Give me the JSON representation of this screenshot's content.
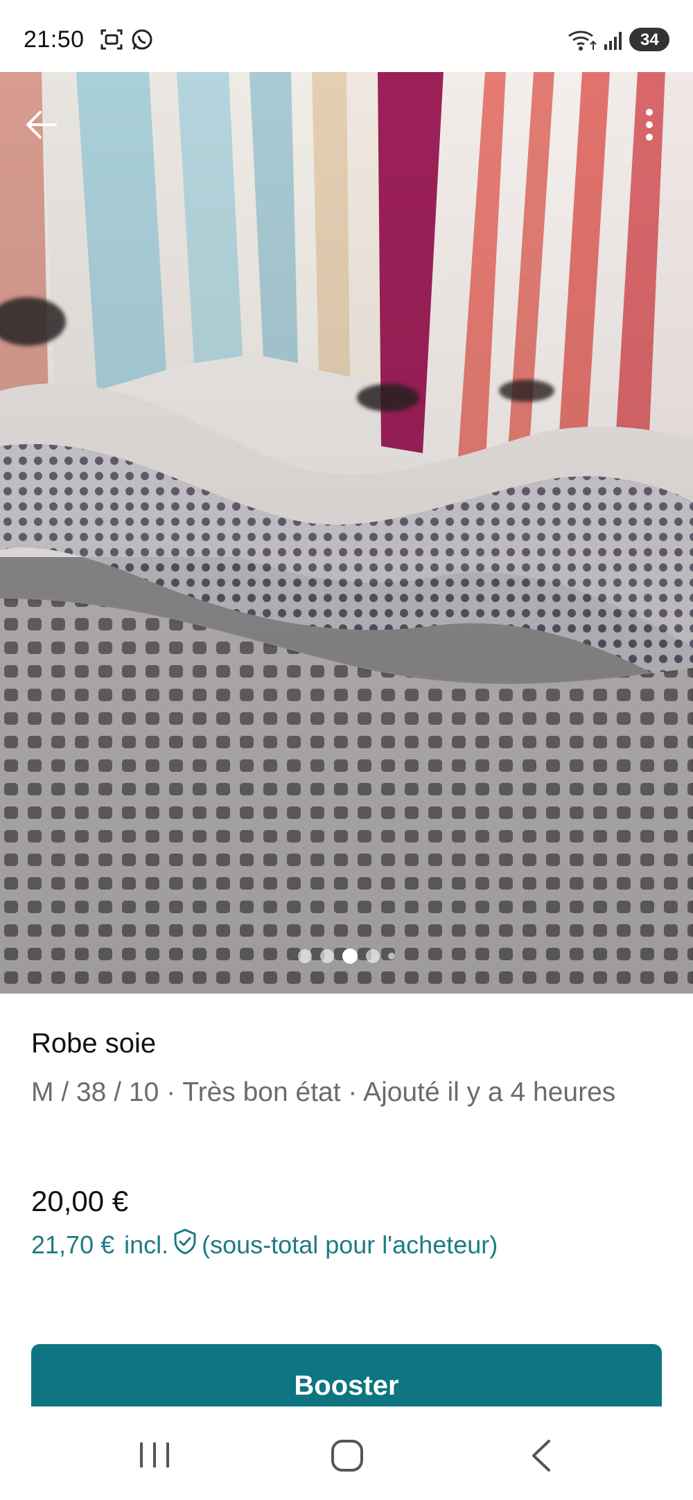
{
  "status_bar": {
    "time": "21:50",
    "battery": "34",
    "icons": [
      "screen-record-icon",
      "whatsapp-icon",
      "wifi-icon",
      "signal-icon",
      "battery-icon"
    ]
  },
  "photo": {
    "page_count": 5,
    "active_index": 2
  },
  "item": {
    "title": "Robe soie",
    "meta": "M / 38 / 10 · Très bon état · Ajouté il y a 4 heures",
    "price": "20,00 €",
    "buyer_price": "21,70 €",
    "buyer_incl": "incl.",
    "buyer_note": "(sous-total pour l'acheteur)"
  },
  "actions": {
    "booster_label": "Booster"
  },
  "colors": {
    "accent": "#0d7581",
    "link": "#1d7b84",
    "meta_text": "#6b6b6b"
  }
}
